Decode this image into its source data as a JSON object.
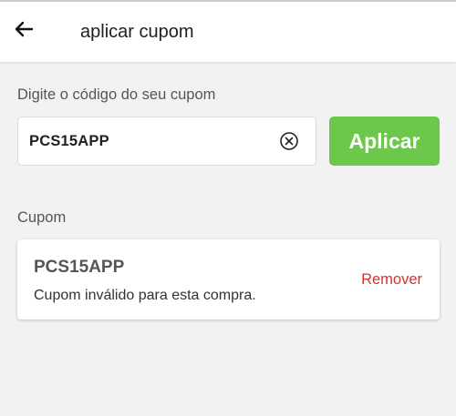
{
  "header": {
    "title": "aplicar cupom",
    "back_icon": "arrow-left-icon"
  },
  "form": {
    "prompt_label": "Digite o código do seu cupom",
    "code_value": "PCS15APP",
    "clear_icon": "clear-circle-x-icon",
    "apply_label": "Aplicar"
  },
  "coupon_section": {
    "label": "Cupom",
    "card": {
      "code": "PCS15APP",
      "status": "Cupom inválido para esta compra.",
      "remove_label": "Remover"
    }
  },
  "colors": {
    "apply_button": "#6cc84a",
    "remove_link": "#d8312a",
    "background": "#f2f2f2"
  }
}
